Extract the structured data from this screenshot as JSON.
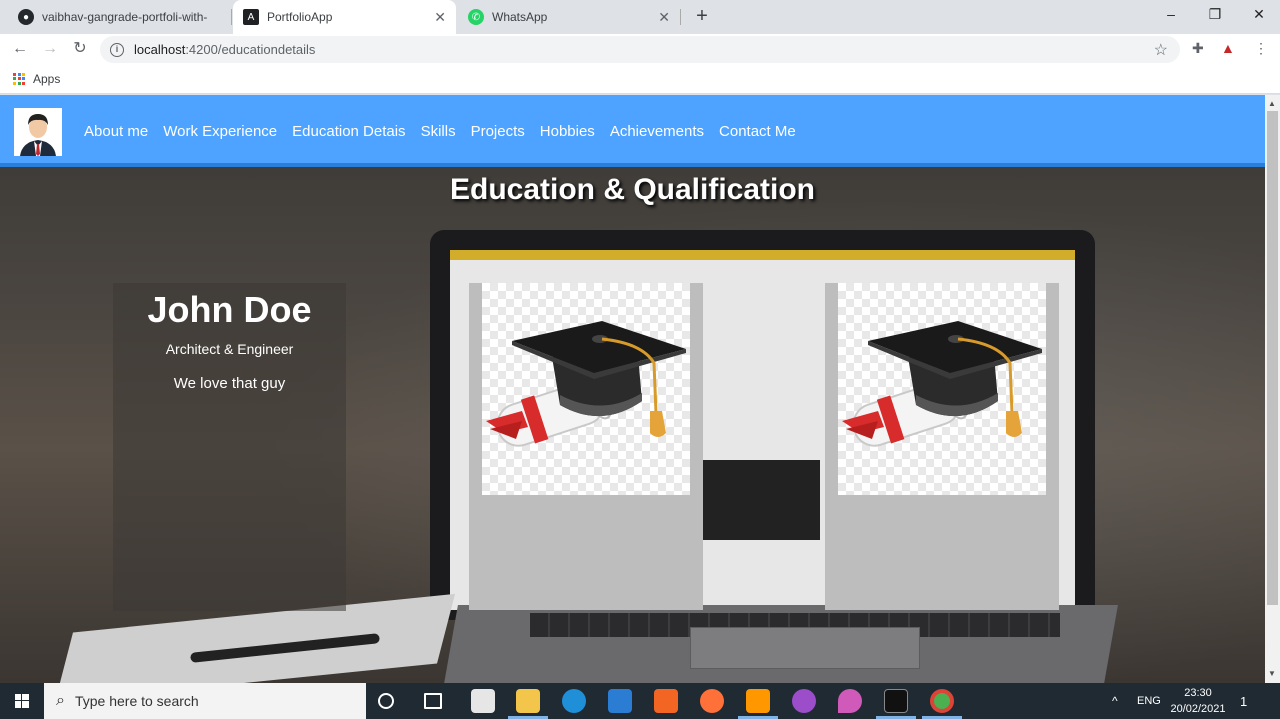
{
  "browser": {
    "tabs": [
      {
        "title": "vaibhav-gangrade-portfoli-with-",
        "icon": "github-icon",
        "active": false
      },
      {
        "title": "PortfolioApp",
        "icon": "angular-icon",
        "active": true
      },
      {
        "title": "WhatsApp",
        "icon": "whatsapp-icon",
        "active": false
      }
    ],
    "new_tab": "+",
    "url_host": "localhost",
    "url_path": ":4200/educationdetails",
    "bookmarks_apps": "Apps",
    "window_controls": {
      "minimize": "–",
      "maximize": "❐",
      "close": "✕"
    }
  },
  "site": {
    "nav_links": [
      "About me",
      "Work Experience",
      "Education Detais",
      "Skills",
      "Projects",
      "Hobbies",
      "Achievements",
      "Contact Me"
    ],
    "nav_color": "#4da3ff",
    "page_title": "Education & Qualification",
    "profile": {
      "name": "John Doe",
      "role": "Architect & Engineer",
      "quote": "We love that guy"
    },
    "cards": [
      {
        "icon": "graduation-cap-icon"
      },
      {
        "icon": "graduation-cap-icon"
      }
    ]
  },
  "taskbar": {
    "search_placeholder": "Type here to search",
    "language": "ENG",
    "time": "23:30",
    "date": "20/02/2021",
    "notifications": "1"
  }
}
